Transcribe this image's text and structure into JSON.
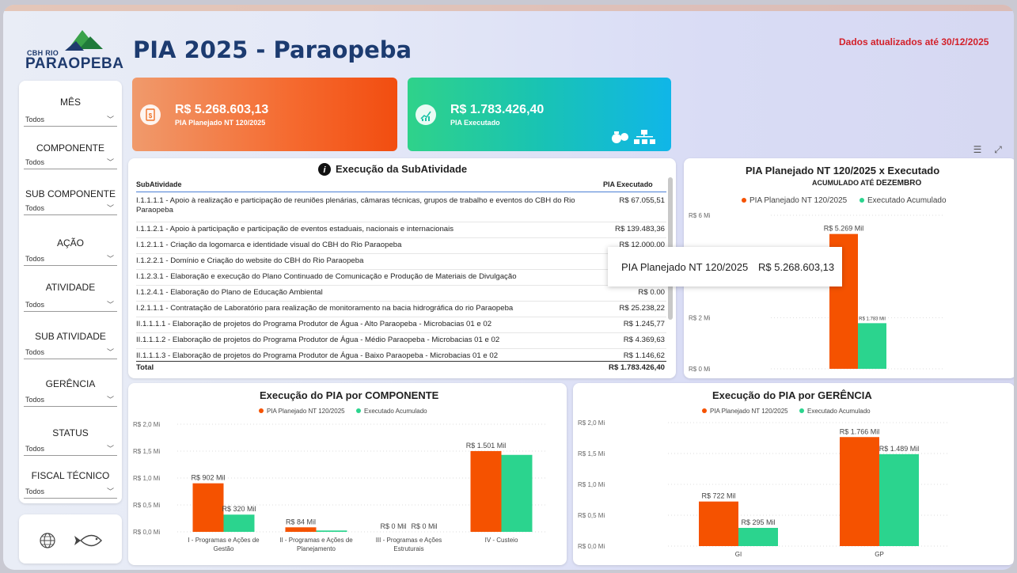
{
  "header": {
    "logo_line1": "CBH RIO",
    "logo_line2": "PARAOPEBA",
    "title": "PIA 2025 - Paraopeba",
    "updated": "Dados atualizados até 30/12/2025"
  },
  "filters": [
    {
      "label": "MÊS",
      "value": "Todos"
    },
    {
      "label": "COMPONENTE",
      "value": "Todos"
    },
    {
      "label": "SUB COMPONENTE",
      "value": "Todos"
    },
    {
      "label": "AÇÃO",
      "value": "Todos"
    },
    {
      "label": "ATIVIDADE",
      "value": "Todos"
    },
    {
      "label": "SUB ATIVIDADE",
      "value": "Todos"
    },
    {
      "label": "GERÊNCIA",
      "value": "Todos"
    },
    {
      "label": "STATUS",
      "value": "Todos"
    },
    {
      "label": "FISCAL TÉCNICO",
      "value": "Todos"
    }
  ],
  "kpis": {
    "planned": {
      "value": "R$ 5.268.603,13",
      "label": "PIA Planejado NT 120/2025"
    },
    "executed": {
      "value": "R$ 1.783.426,40",
      "label": "PIA Executado"
    }
  },
  "table": {
    "title": "Execução da SubAtividade",
    "columns": [
      "SubAtividade",
      "PIA Executado"
    ],
    "rows": [
      [
        "I.1.1.1.1 - Apoio à realização e participação de reuniões plenárias, câmaras técnicas, grupos de trabalho e eventos do CBH do Rio Paraopeba",
        "R$ 67.055,51"
      ],
      [
        "I.1.1.2.1 - Apoio à participação e participação de eventos estaduais, nacionais e internacionais",
        "R$ 139.483,36"
      ],
      [
        "I.1.2.1.1 - Criação da logomarca e identidade visual do CBH do Rio Paraopeba",
        "R$ 12.000,00"
      ],
      [
        "I.1.2.2.1 - Domínio e Criação do website do CBH do Rio Paraopeba",
        ""
      ],
      [
        "I.1.2.3.1 - Elaboração e execução do Plano Continuado de Comunicação e Produção de Materiais de Divulgação",
        ""
      ],
      [
        "I.1.2.4.1 - Elaboração do Plano de Educação Ambiental",
        "R$ 0.00"
      ],
      [
        "I.2.1.1.1 - Contratação de Laboratório para realização de monitoramento na bacia hidrográfica do rio Paraopeba",
        "R$ 25.238,22"
      ],
      [
        "II.1.1.1.1 - Elaboração de projetos do Programa Produtor de Água - Alto Paraopeba - Microbacias 01 e 02",
        "R$ 1.245,77"
      ],
      [
        "II.1.1.1.2 - Elaboração de projetos do Programa Produtor de Água - Médio Paraopeba - Microbacias 01 e 02",
        "R$ 4.369,63"
      ],
      [
        "II.1.1.1.3 - Elaboração de projetos do Programa Produtor de Água - Baixo Paraopeba - Microbacias 01 e 02",
        "R$ 1.146,62"
      ]
    ],
    "total_label": "Total",
    "total_value": "R$ 1.783.426,40"
  },
  "tooltip": {
    "series": "PIA Planejado NT 120/2025",
    "value": "R$ 5.268.603,13"
  },
  "colors": {
    "planned": "#f55200",
    "executed": "#2bd48e",
    "accent_red": "#d3202a",
    "title_blue": "#1c3b70"
  },
  "chart_data": [
    {
      "type": "bar",
      "title": "PIA Planejado NT 120/2025 x Executado",
      "subtitle_prefix": "ACUMULADO ATÉ",
      "subtitle_bold": "DEZEMBRO",
      "categories": [
        ""
      ],
      "series": [
        {
          "name": "PIA Planejado NT 120/2025",
          "values": [
            5.269
          ],
          "labels": [
            "R$ 5.269 Mil"
          ]
        },
        {
          "name": "Executado Acumulado",
          "values": [
            1.783
          ],
          "labels": [
            "R$ 1.783 Mil"
          ]
        }
      ],
      "ylim": [
        0,
        6
      ],
      "yticks": [
        {
          "v": 0,
          "t": "R$ 0 Mi"
        },
        {
          "v": 2,
          "t": "R$ 2 Mi"
        },
        {
          "v": 6,
          "t": "R$ 6 Mi"
        }
      ],
      "legend": "top"
    },
    {
      "type": "bar",
      "title": "Execução do PIA por COMPONENTE",
      "categories": [
        "I - Programas e Ações de Gestão",
        "II - Programas e Ações de Planejamento",
        "III - Programas e Ações Estruturais",
        "IV - Custeio"
      ],
      "category_lines": [
        [
          "I - Programas e Ações de",
          "Gestão"
        ],
        [
          "II - Programas e Ações de",
          "Planejamento"
        ],
        [
          "III - Programas e Ações",
          "Estruturais"
        ],
        [
          "IV - Custeio"
        ]
      ],
      "series": [
        {
          "name": "PIA Planejado NT 120/2025",
          "values": [
            0.902,
            0.084,
            0,
            1.501
          ],
          "labels": [
            "R$ 902 Mil",
            "R$ 84 Mil",
            "R$ 0 Mil",
            "R$ 1.501 Mil"
          ]
        },
        {
          "name": "Executado Acumulado",
          "values": [
            0.32,
            0.025,
            0,
            1.43
          ],
          "labels": [
            "R$ 320 Mil",
            "",
            "R$ 0 Mil",
            ""
          ]
        }
      ],
      "ylim": [
        0,
        2.0
      ],
      "yticks": [
        {
          "v": 0,
          "t": "R$ 0,0 Mi"
        },
        {
          "v": 0.5,
          "t": "R$ 0,5 Mi"
        },
        {
          "v": 1.0,
          "t": "R$ 1,0 Mi"
        },
        {
          "v": 1.5,
          "t": "R$ 1,5 Mi"
        },
        {
          "v": 2.0,
          "t": "R$ 2,0 Mi"
        }
      ],
      "legend": "top"
    },
    {
      "type": "bar",
      "title": "Execução do PIA por GERÊNCIA",
      "categories": [
        "GI",
        "GP"
      ],
      "category_lines": [
        [
          "GI"
        ],
        [
          "GP"
        ]
      ],
      "series": [
        {
          "name": "PIA Planejado NT 120/2025",
          "values": [
            0.722,
            1.766
          ],
          "labels": [
            "R$ 722 Mil",
            "R$ 1.766 Mil"
          ]
        },
        {
          "name": "Executado Acumulado",
          "values": [
            0.295,
            1.489
          ],
          "labels": [
            "R$ 295 Mil",
            "R$ 1.489 Mil"
          ]
        }
      ],
      "ylim": [
        0,
        2.0
      ],
      "yticks": [
        {
          "v": 0,
          "t": "R$ 0,0 Mi"
        },
        {
          "v": 0.5,
          "t": "R$ 0,5 Mi"
        },
        {
          "v": 1.0,
          "t": "R$ 1,0 Mi"
        },
        {
          "v": 1.5,
          "t": "R$ 1,5 Mi"
        },
        {
          "v": 2.0,
          "t": "R$ 2,0 Mi"
        }
      ],
      "legend": "top"
    }
  ]
}
